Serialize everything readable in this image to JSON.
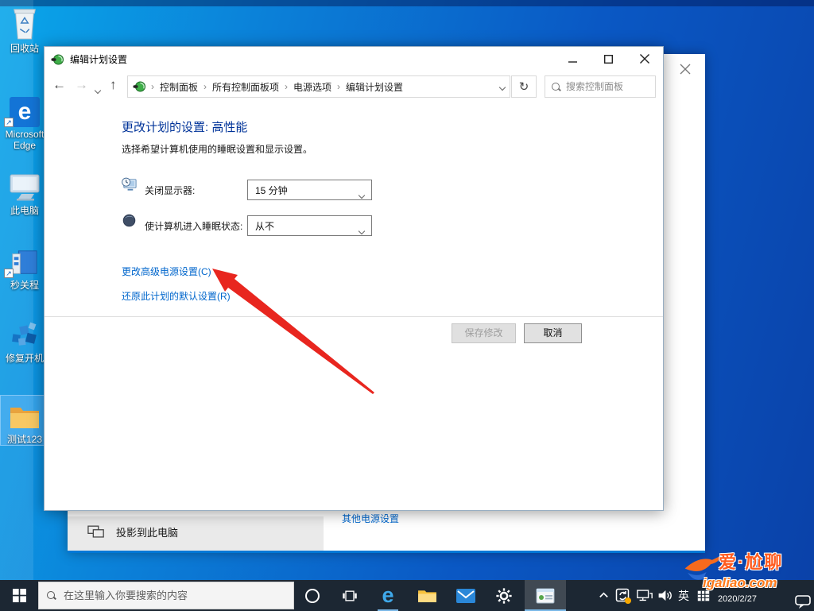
{
  "desktop": {
    "icons": [
      {
        "label": "回收站"
      },
      {
        "label": "Microsoft Edge"
      },
      {
        "label": "此电脑"
      },
      {
        "label": "秒关程"
      },
      {
        "label": "修复开机"
      },
      {
        "label": "测试123"
      }
    ],
    "shortcut_glyph": "↗"
  },
  "edit_window": {
    "title": "编辑计划设置",
    "nav": {
      "back_glyph": "←",
      "forward_glyph": "→",
      "up_glyph": "↑",
      "refresh_glyph": "↻",
      "separator": "›",
      "breadcrumb": [
        "控制面板",
        "所有控制面板项",
        "电源选项",
        "编辑计划设置"
      ],
      "search_placeholder": "搜索控制面板"
    },
    "heading": "更改计划的设置: 高性能",
    "subtitle": "选择希望计算机使用的睡眠设置和显示设置。",
    "settings": [
      {
        "label": "关闭显示器:",
        "value": "15 分钟"
      },
      {
        "label": "使计算机进入睡眠状态:",
        "value": "从不"
      }
    ],
    "links": {
      "advanced": "更改高级电源设置(C)",
      "restore": "还原此计划的默认设置(R)"
    },
    "buttons": {
      "save": "保存修改",
      "cancel": "取消"
    }
  },
  "settings_window": {
    "project_item": "投影到此电脑",
    "other_power_link": "其他电源设置"
  },
  "taskbar": {
    "search_placeholder": "在这里输入你要搜索的内容",
    "edge_glyph": "e",
    "language": "英",
    "date": "2020/2/27"
  },
  "watermark": {
    "brand": "爱·尬聊",
    "site": "igaliao.com"
  },
  "colors": {
    "accent": "#0078d7",
    "link": "#0066cc",
    "heading": "#003399",
    "arrow": "#e8261f"
  }
}
